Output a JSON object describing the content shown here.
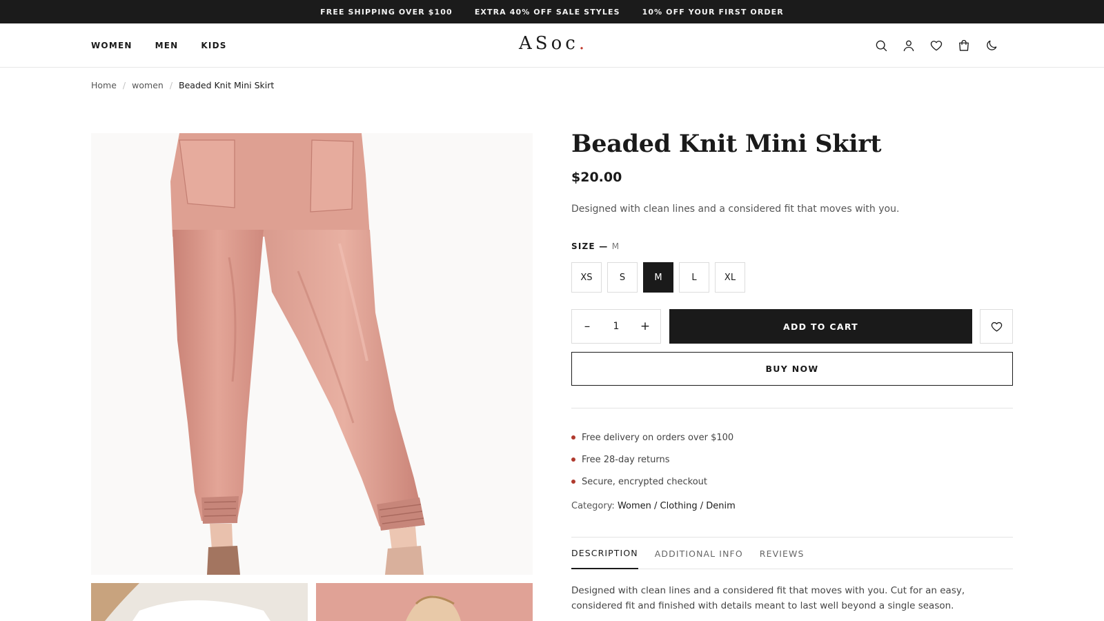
{
  "announcement": {
    "items": [
      "FREE SHIPPING OVER $100",
      "EXTRA 40% OFF SALE STYLES",
      "10% OFF YOUR FIRST ORDER"
    ]
  },
  "header": {
    "nav": [
      "WOMEN",
      "MEN",
      "KIDS"
    ],
    "logo": "ASoc",
    "logo_dot": ".",
    "icons": [
      "search-icon",
      "account-icon",
      "wishlist-icon",
      "cart-icon",
      "dark-mode-icon"
    ]
  },
  "breadcrumb": {
    "items": [
      "Home",
      "women"
    ],
    "separator": "/",
    "current": "Beaded Knit Mini Skirt"
  },
  "product": {
    "title": "Beaded Knit Mini Skirt",
    "price": "$20.00",
    "lead": "Designed with clean lines and a considered fit that moves with you.",
    "size_label": "SIZE",
    "size_dash": "—",
    "size_selected": "M",
    "sizes": [
      "XS",
      "S",
      "M",
      "L",
      "XL"
    ],
    "quantity": "1",
    "qty_minus": "–",
    "qty_plus": "+",
    "add_to_cart": "ADD TO CART",
    "buy_now": "BUY NOW",
    "perks": [
      "Free delivery on orders over $100",
      "Free 28-day returns",
      "Secure, encrypted checkout"
    ],
    "category_label": "Category:",
    "category_value": "Women / Clothing / Denim"
  },
  "tabs": {
    "items": [
      "DESCRIPTION",
      "ADDITIONAL INFO",
      "REVIEWS"
    ],
    "active": "DESCRIPTION"
  },
  "description": "Designed with clean lines and a considered fit that moves with you. Cut for an easy, considered fit and finished with details meant to last well beyond a single season.",
  "colors": {
    "accent": "#b03a2e",
    "dark": "#1b1b1b",
    "product_pink": "#d99a8e"
  }
}
